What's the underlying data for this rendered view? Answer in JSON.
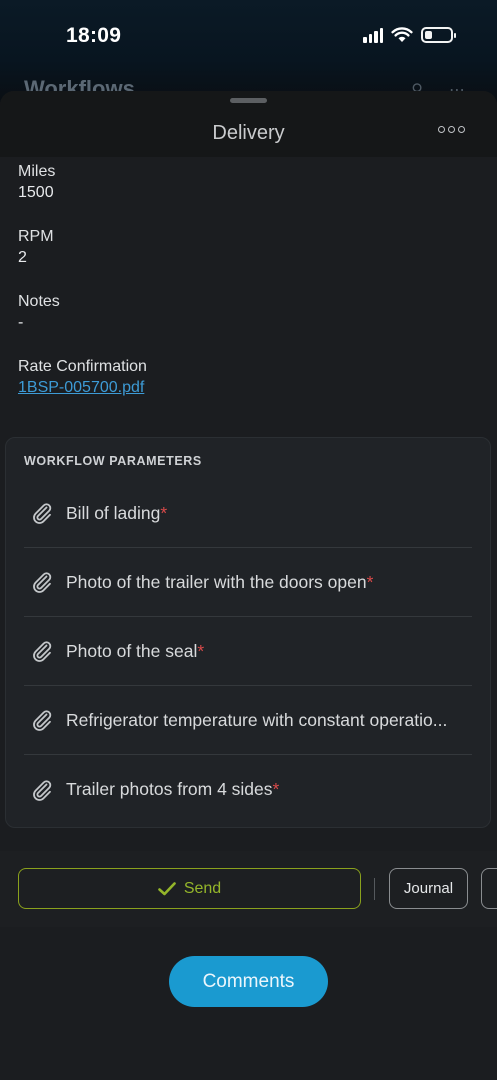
{
  "status_bar": {
    "time": "18:09",
    "battery_percent": 30
  },
  "background_page": {
    "title": "Workflows"
  },
  "sheet": {
    "title": "Delivery",
    "fields": [
      {
        "label": "Miles",
        "value": "1500"
      },
      {
        "label": "RPM",
        "value": "2"
      },
      {
        "label": "Notes",
        "value": "-"
      }
    ],
    "rate_confirmation": {
      "label": "Rate Confirmation",
      "file": "1BSP-005700.pdf"
    },
    "workflow_parameters": {
      "title": "WORKFLOW PARAMETERS",
      "items": [
        {
          "label": "Bill of lading",
          "required_mark": "*",
          "icon": "paperclip-icon"
        },
        {
          "label": "Photo of the trailer with the doors open",
          "required_mark": "*",
          "icon": "paperclip-icon"
        },
        {
          "label": "Photo of the seal",
          "required_mark": "*",
          "icon": "paperclip-icon"
        },
        {
          "label": "Refrigerator temperature with constant operatio...",
          "required_mark": "",
          "icon": "paperclip-icon"
        },
        {
          "label": "Trailer photos from 4 sides",
          "required_mark": "*",
          "icon": "paperclip-icon"
        }
      ]
    },
    "actions": {
      "send_label": "Send",
      "journal_label": "Journal"
    },
    "comments_label": "Comments"
  },
  "colors": {
    "accent_blue": "#1a9ad0",
    "send_green": "#94b52a",
    "required_red": "#d94a4a",
    "link_blue": "#3d9bd6"
  }
}
